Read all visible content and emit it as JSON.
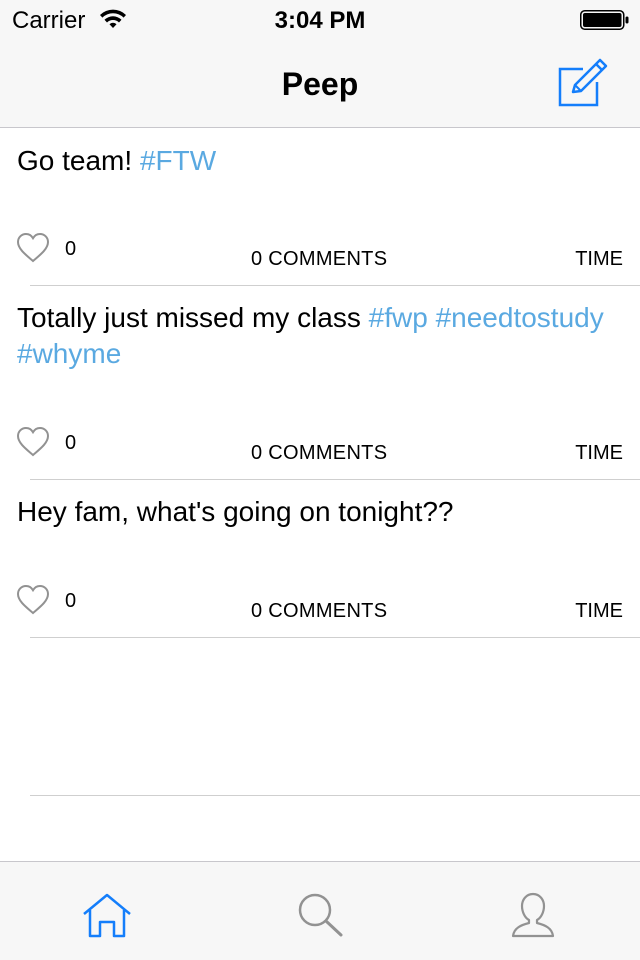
{
  "status_bar": {
    "carrier": "Carrier",
    "time": "3:04 PM"
  },
  "nav": {
    "title": "Peep",
    "compose_icon": "compose-icon"
  },
  "posts": [
    {
      "text_parts": [
        {
          "text": "Go team! ",
          "hashtag": false
        },
        {
          "text": "#FTW",
          "hashtag": true
        }
      ],
      "likes": "0",
      "comments": "0 COMMENTS",
      "time": "TIME"
    },
    {
      "text_parts": [
        {
          "text": "Totally just missed my class ",
          "hashtag": false
        },
        {
          "text": "#fwp",
          "hashtag": true
        },
        {
          "text": " ",
          "hashtag": false
        },
        {
          "text": "#needtostudy",
          "hashtag": true
        },
        {
          "text": " ",
          "hashtag": false
        },
        {
          "text": "#whyme",
          "hashtag": true
        }
      ],
      "likes": "0",
      "comments": "0 COMMENTS",
      "time": "TIME"
    },
    {
      "text_parts": [
        {
          "text": "Hey fam, what's going on tonight??",
          "hashtag": false
        }
      ],
      "likes": "0",
      "comments": "0 COMMENTS",
      "time": "TIME"
    }
  ],
  "tabs": [
    {
      "icon": "home-icon",
      "active": true
    },
    {
      "icon": "search-icon",
      "active": false
    },
    {
      "icon": "profile-icon",
      "active": false
    }
  ],
  "colors": {
    "accent": "#147efb",
    "hashtag": "#5aa9e1",
    "inactive_icon": "#929292"
  }
}
